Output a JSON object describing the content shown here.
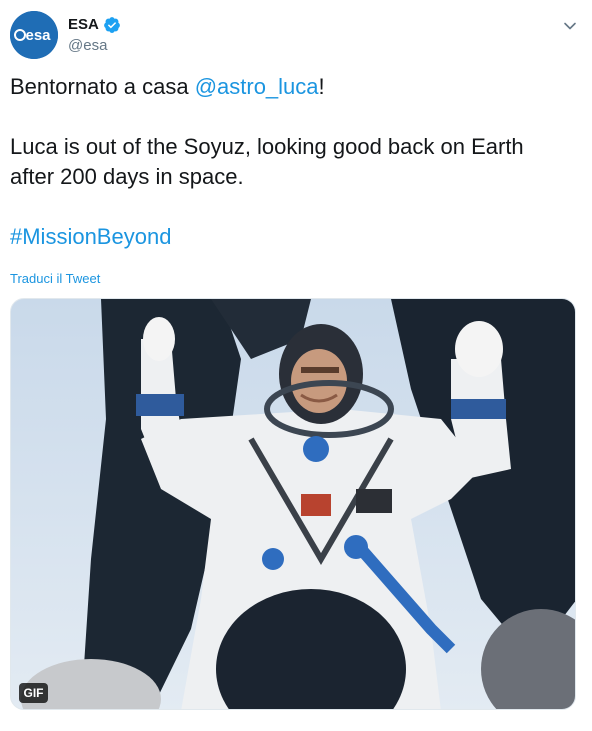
{
  "author": {
    "display_name": "ESA",
    "handle": "@esa",
    "verified": true,
    "avatar_logo_text": "esa",
    "avatar_color": "#1f6db5"
  },
  "tweet": {
    "line1_prefix": "Bentornato a casa ",
    "line1_mention": "@astro_luca",
    "line1_suffix": "!",
    "line2": "Luca is out of the Soyuz, looking good back on Earth after 200 days in space.",
    "hashtag": "#MissionBeyond",
    "translate_label": "Traduci il Tweet"
  },
  "media": {
    "badge": "GIF",
    "description_icon": "astronaut-photo"
  },
  "icons": {
    "verified": "verified-badge-icon",
    "caret": "chevron-down-icon"
  },
  "colors": {
    "link": "#1b95e0",
    "text": "#14171a",
    "muted": "#657786"
  }
}
